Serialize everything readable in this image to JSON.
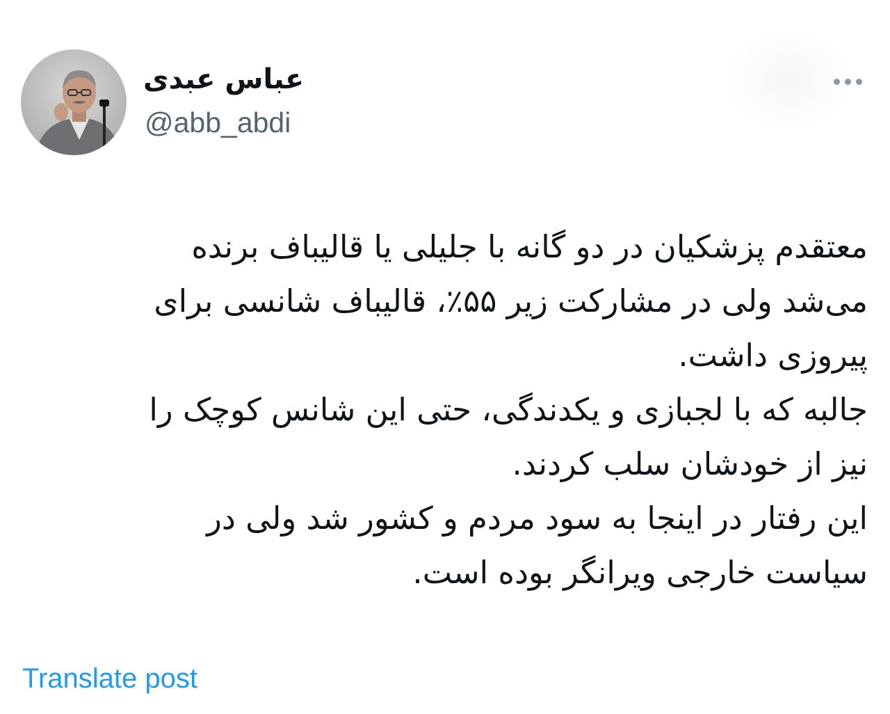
{
  "author": {
    "display_name": "عباس عبدی",
    "handle": "@abb_abdi"
  },
  "post": {
    "lines": [
      "معتقدم پزشکیان در دو گانه با جلیلی یا قالیباف برنده",
      "می‌شد ولی در مشارکت زیر ۵۵٪، قالیباف شانسی برای",
      "پیروزی داشت.",
      "جالبه که با لجبازی و یکدندگی، حتی این شانس کوچک را",
      "نیز از خودشان سلب کردند.",
      "این رفتار در اینجا به سود مردم و کشور شد ولی در",
      "سیاست خارجی ویرانگر بوده است."
    ]
  },
  "actions": {
    "translate_label": "Translate post",
    "more_icon": "more-horizontal-icon"
  },
  "colors": {
    "text": "#0f1419",
    "secondary": "#536471",
    "link": "#1d9bf0"
  }
}
